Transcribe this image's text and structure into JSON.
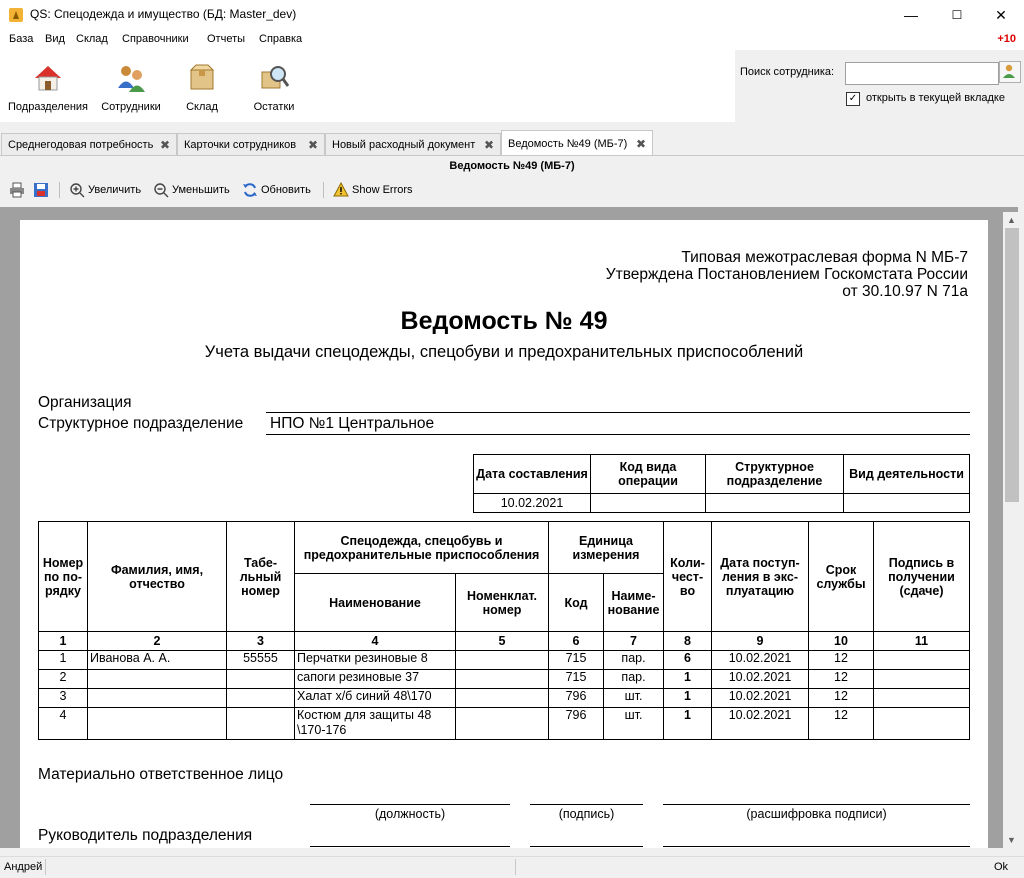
{
  "window": {
    "title": "QS: Спецодежда и имущество (БД: Master_dev)",
    "minimize": "—",
    "maximize": "☐",
    "close": "✕"
  },
  "menu": {
    "items": [
      "База",
      "Вид",
      "Склад",
      "Справочники",
      "Отчеты",
      "Справка"
    ],
    "notification": "+10"
  },
  "toolbar": {
    "buttons": [
      {
        "label": "Подразделения",
        "icon": "house-icon"
      },
      {
        "label": "Сотрудники",
        "icon": "people-icon"
      },
      {
        "label": "Склад",
        "icon": "box-icon"
      },
      {
        "label": "Остатки",
        "icon": "magnifier-icon"
      }
    ]
  },
  "search": {
    "label": "Поиск сотрудника:",
    "value": "",
    "checkbox_label": "открыть в текущей вкладке",
    "checkbox_checked": true
  },
  "tabs": [
    {
      "label": "Среднегодовая потребность"
    },
    {
      "label": "Карточки сотрудников"
    },
    {
      "label": "Новый расходный документ"
    },
    {
      "label": "Ведомость №49 (МБ-7)",
      "active": true
    }
  ],
  "report_title": "Ведомость №49 (МБ-7)",
  "report_toolbar": {
    "zoom_in": "Увеличить",
    "zoom_out": "Уменьшить",
    "refresh": "Обновить",
    "show_errors": "Show Errors"
  },
  "doc": {
    "form_line1": "Типовая межотраслевая форма N МБ-7",
    "form_line2": "Утверждена Постановлением Госкомстата России",
    "form_line3": "от 30.10.97 N 71а",
    "title": "Ведомость № 49",
    "subtitle": "Учета выдачи спецодежды, спецобуви и предохранительных приспособлений",
    "org_label": "Организация",
    "org_value": "",
    "dept_label": "Структурное подразделение",
    "dept_value": "НПО №1 Центральное",
    "head_table": {
      "headers": [
        "Дата составления",
        "Код вида операции",
        "Структурное подразделение",
        "Вид деятельности"
      ],
      "values": [
        "10.02.2021",
        "",
        "",
        ""
      ]
    },
    "main_table": {
      "h_num": "Номер по по-рядку",
      "h_fio": "Фамилия, имя, отчество",
      "h_tab": "Табе-льный номер",
      "h_goods": "Спецодежда, спецобувь и предохранительные приспособления",
      "h_name": "Наименование",
      "h_nomen": "Номенклат. номер",
      "h_unit": "Единица измерения",
      "h_code": "Код",
      "h_uname": "Наиме-нование",
      "h_qty": "Коли-чест-во",
      "h_date": "Дата поступ-ления в экс-плуатацию",
      "h_term": "Срок службы",
      "h_sign": "Подпись в получении (сдаче)",
      "col_numbers": [
        "1",
        "2",
        "3",
        "4",
        "5",
        "6",
        "7",
        "8",
        "9",
        "10",
        "11"
      ],
      "rows": [
        {
          "n": "1",
          "fio": "Иванова А. А.",
          "tab": "55555",
          "name": "Перчатки резиновые 8",
          "nomen": "",
          "code": "715",
          "unit": "пар.",
          "qty": "6",
          "date": "10.02.2021",
          "term": "12",
          "sign": ""
        },
        {
          "n": "2",
          "fio": "",
          "tab": "",
          "name": "сапоги резиновые 37",
          "nomen": "",
          "code": "715",
          "unit": "пар.",
          "qty": "1",
          "date": "10.02.2021",
          "term": "12",
          "sign": ""
        },
        {
          "n": "3",
          "fio": "",
          "tab": "",
          "name": "Халат х/б синий 48\\170",
          "nomen": "",
          "code": "796",
          "unit": "шт.",
          "qty": "1",
          "date": "10.02.2021",
          "term": "12",
          "sign": ""
        },
        {
          "n": "4",
          "fio": "",
          "tab": "",
          "name": "Костюм для защиты 48 \\170-176",
          "nomen": "",
          "code": "796",
          "unit": "шт.",
          "qty": "1",
          "date": "10.02.2021",
          "term": "12",
          "sign": ""
        }
      ]
    },
    "resp_label": "Материально ответственное лицо",
    "pos_caption": "(должность)",
    "sign_caption": "(подпись)",
    "decode_caption": "(расшифровка подписи)",
    "head_label": "Руководитель подразделения"
  },
  "status": {
    "user": "Андрей",
    "state": "Ok"
  }
}
